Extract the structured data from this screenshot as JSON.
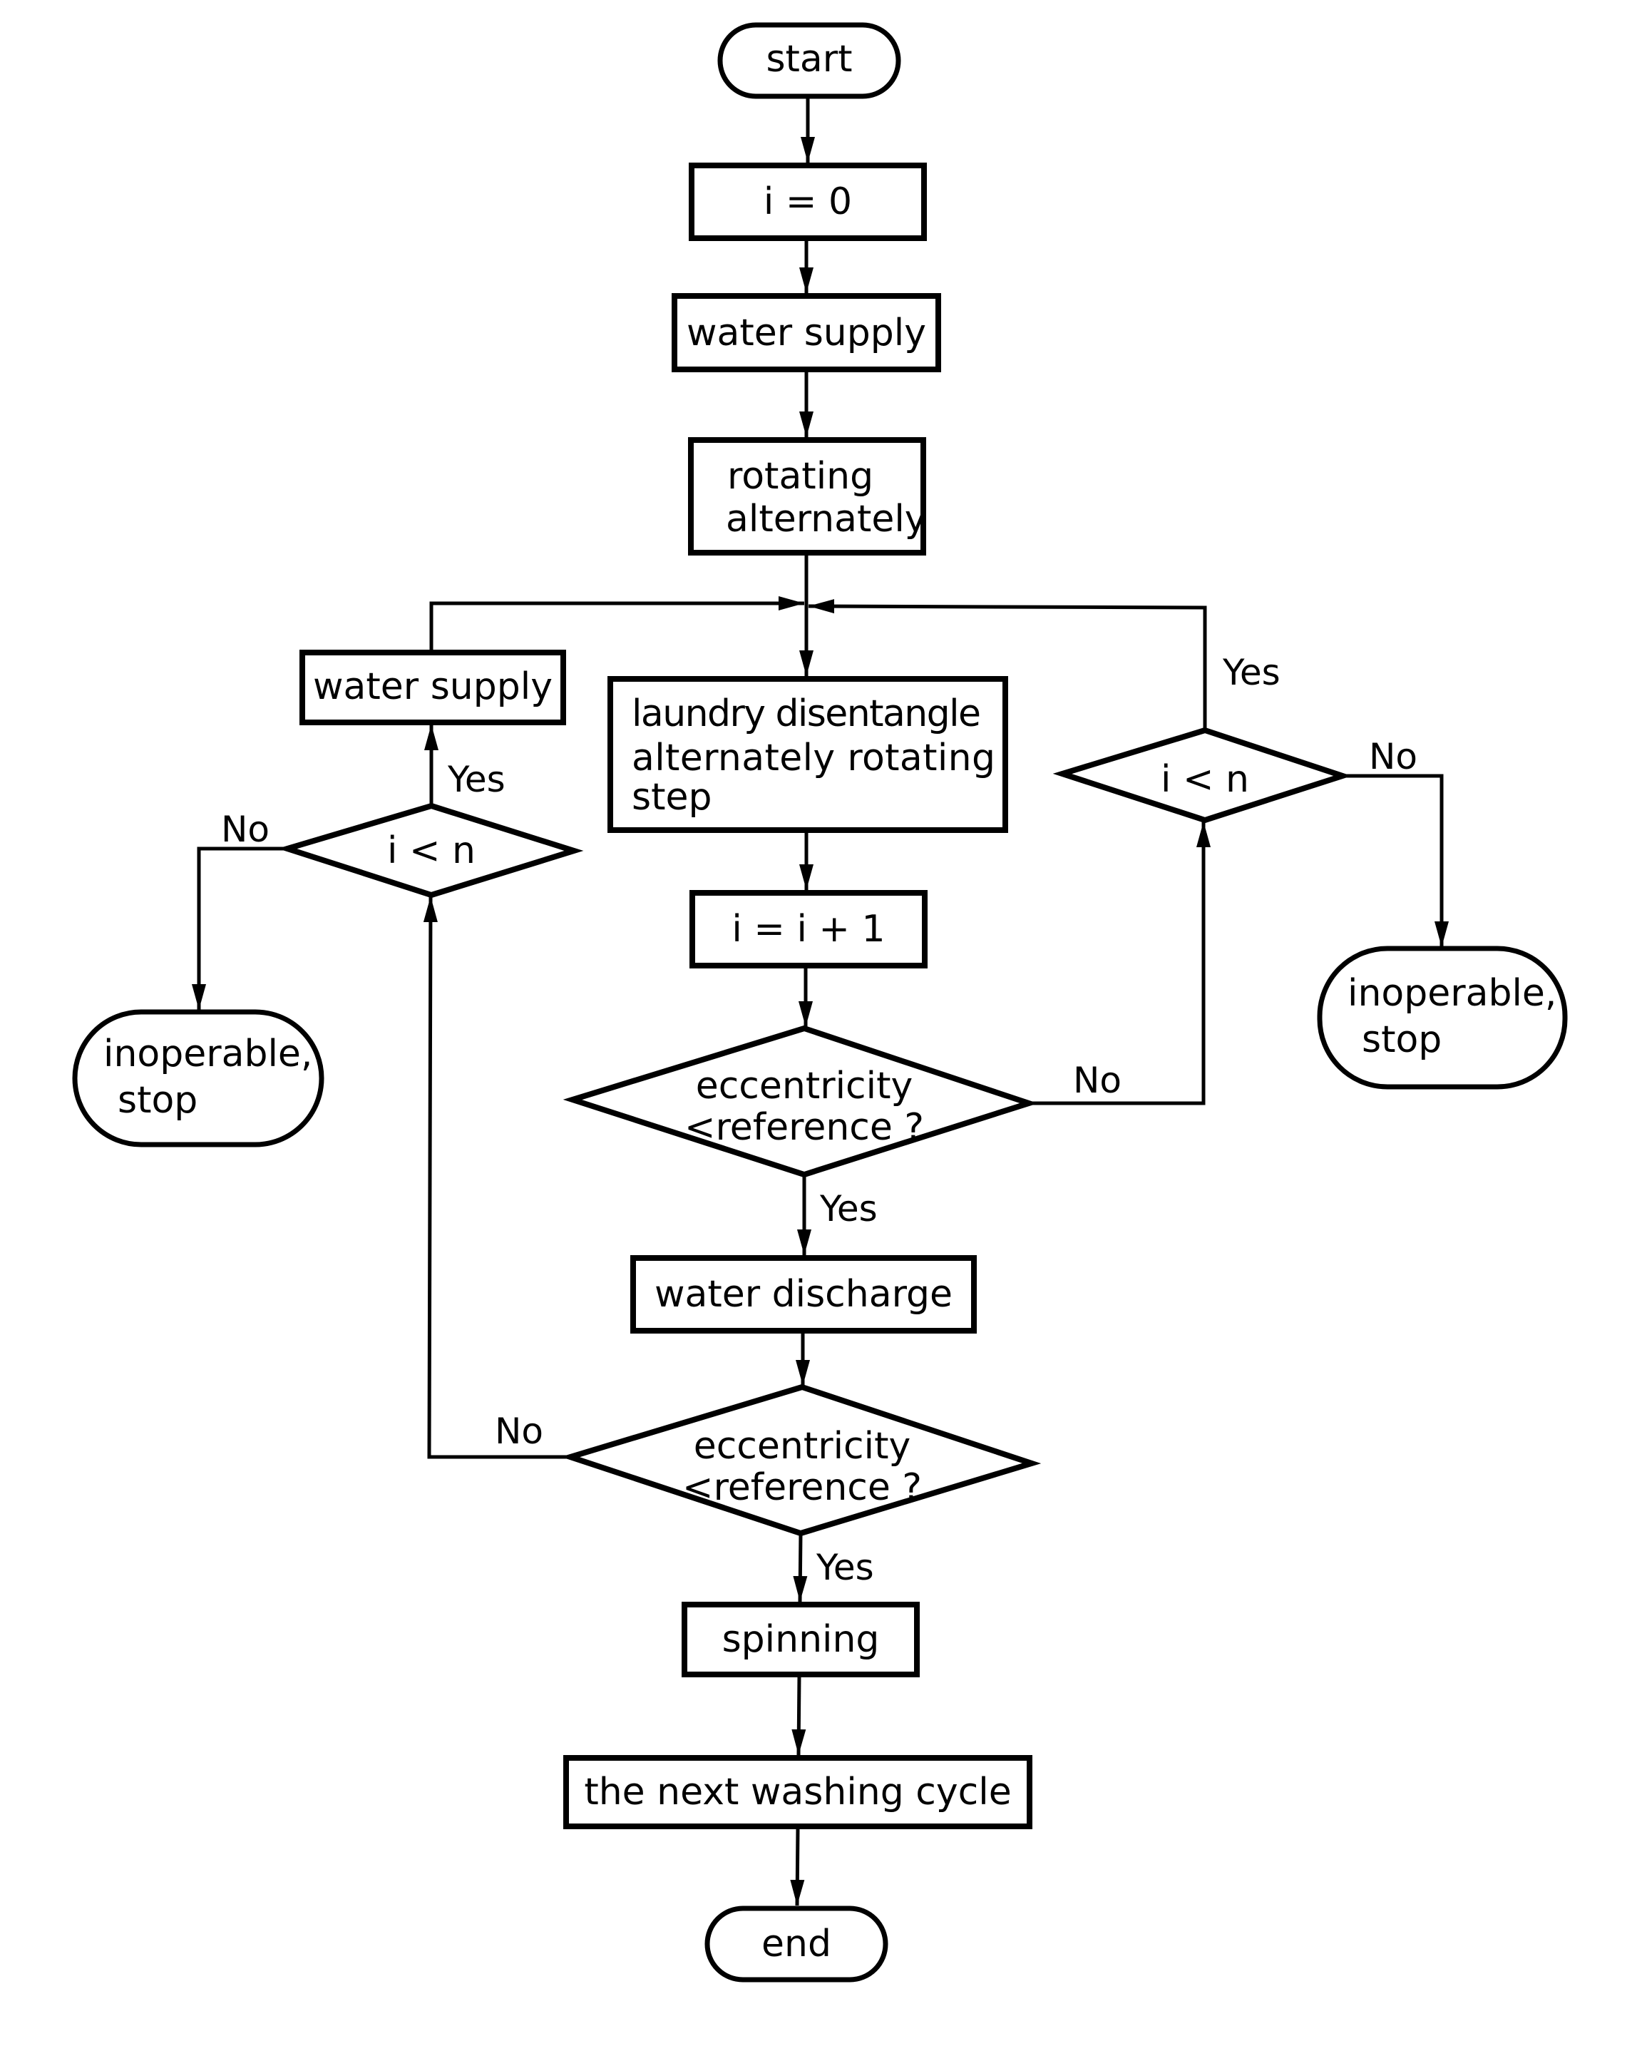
{
  "diagram": {
    "type": "flowchart",
    "colors": {
      "stroke": "#000000",
      "background": "#ffffff"
    },
    "nodes": {
      "start": {
        "kind": "terminal",
        "text": "start"
      },
      "init_counter": {
        "kind": "process",
        "text": "i = 0"
      },
      "water_supply_main": {
        "kind": "process",
        "text": "water supply"
      },
      "rotating_alternately": {
        "kind": "process",
        "lines": [
          "rotating",
          "alternately"
        ]
      },
      "disentangle_step": {
        "kind": "process",
        "lines": [
          "laundry disentangle",
          "alternately  rotating",
          "step"
        ]
      },
      "increment_counter": {
        "kind": "process",
        "text": "i = i + 1"
      },
      "eccentricity_check_1": {
        "kind": "decision",
        "lines": [
          "eccentricity",
          "<reference ?"
        ]
      },
      "water_discharge": {
        "kind": "process",
        "text": "water discharge"
      },
      "eccentricity_check_2": {
        "kind": "decision",
        "lines": [
          "eccentricity",
          "<reference ?"
        ]
      },
      "spinning": {
        "kind": "process",
        "text": "spinning"
      },
      "next_washing_cycle": {
        "kind": "process",
        "text": "the next washing cycle"
      },
      "end": {
        "kind": "terminal",
        "text": "end"
      },
      "left_retry_check": {
        "kind": "decision",
        "text": "i < n"
      },
      "left_water_supply": {
        "kind": "process",
        "text": "water supply"
      },
      "left_stop": {
        "kind": "terminal",
        "lines": [
          "inoperable,",
          "stop"
        ]
      },
      "right_retry_check": {
        "kind": "decision",
        "text": "i < n"
      },
      "right_stop": {
        "kind": "terminal",
        "lines": [
          "inoperable,",
          "stop"
        ]
      }
    },
    "edge_labels": {
      "left_check_yes": "Yes",
      "left_check_no": "No",
      "right_check_yes": "Yes",
      "right_check_no": "No",
      "ecc1_yes": "Yes",
      "ecc1_no": "No",
      "ecc2_yes": "Yes",
      "ecc2_no": "No"
    }
  }
}
